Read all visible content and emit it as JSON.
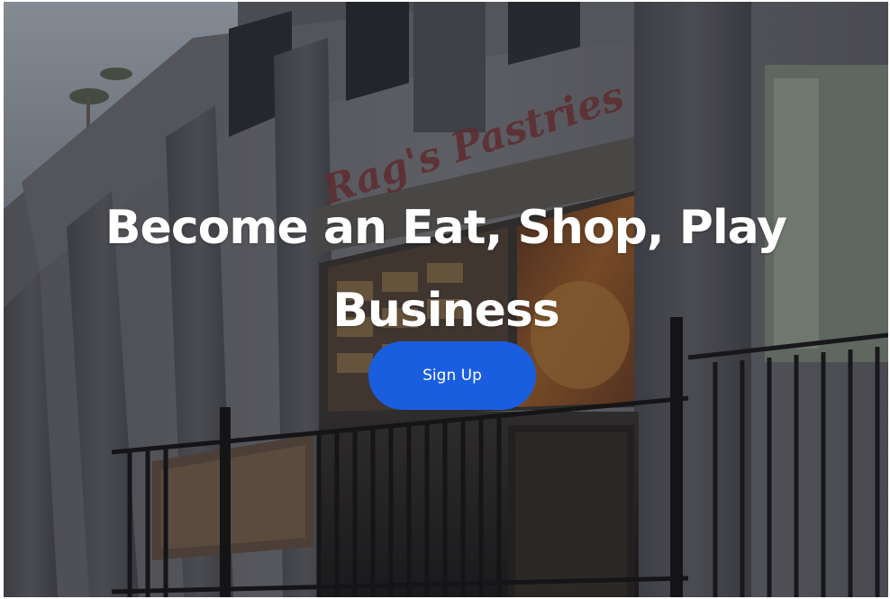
{
  "hero": {
    "sign_text": "Rag's Pastries",
    "title_line1": "Become an Eat, Shop, Play",
    "title_line2": "Business",
    "cta_label": "Sign Up",
    "colors": {
      "cta_background": "#1a5ee0",
      "title_text": "#ffffff"
    }
  }
}
